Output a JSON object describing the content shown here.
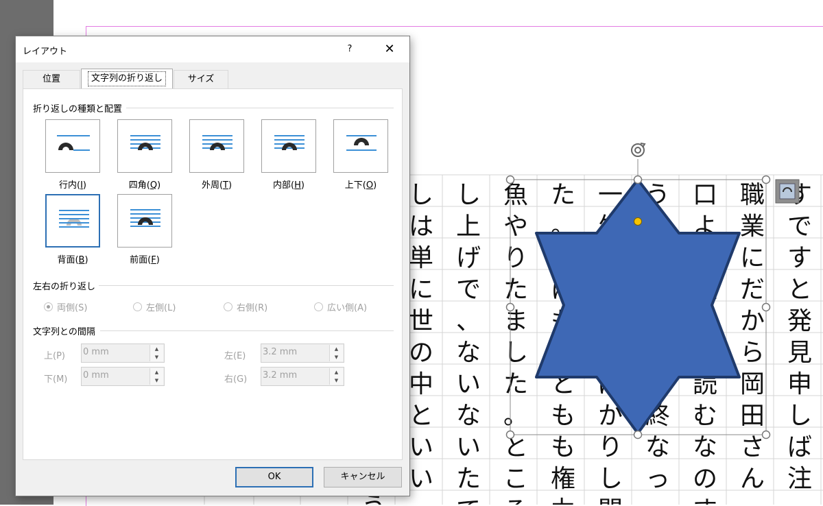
{
  "dialog": {
    "title": "レイアウト",
    "help": "?",
    "close": "✕",
    "tabs": {
      "position": "位置",
      "wrap": "文字列の折り返し",
      "size": "サイズ"
    },
    "wrap_section": {
      "title": "折り返しの種類と配置",
      "options": [
        {
          "label": "行内(I)",
          "key": "I",
          "style": "inline"
        },
        {
          "label": "四角(Q)",
          "key": "Q",
          "style": "square"
        },
        {
          "label": "外周(T)",
          "key": "T",
          "style": "tight"
        },
        {
          "label": "内部(H)",
          "key": "H",
          "style": "through"
        },
        {
          "label": "上下(O)",
          "key": "O",
          "style": "topbottom"
        },
        {
          "label": "背面(B)",
          "key": "B",
          "style": "behind",
          "selected": true
        },
        {
          "label": "前面(F)",
          "key": "F",
          "style": "front"
        }
      ]
    },
    "side_section": {
      "title": "左右の折り返し",
      "options": [
        {
          "label": "両側(S)",
          "checked": true
        },
        {
          "label": "左側(L)",
          "checked": false
        },
        {
          "label": "右側(R)",
          "checked": false
        },
        {
          "label": "広い側(A)",
          "checked": false
        }
      ]
    },
    "distance_section": {
      "title": "文字列との間隔",
      "top_label": "上(P)",
      "top_value": "0 mm",
      "bottom_label": "下(M)",
      "bottom_value": "0 mm",
      "left_label": "左(E)",
      "left_value": "3.2 mm",
      "right_label": "右(G)",
      "right_value": "3.2 mm"
    },
    "ok": "OK",
    "cancel": "キャンセル"
  },
  "document": {
    "columns": [
      "すですと発見申しば注",
      "職業にだから岡田さん",
      "口より致しと読むなのす",
      "うでしょと〕始終なっ",
      "一生のところばかりし閉",
      "た。私はもっともも権力な",
      "魚やりたました。ところが",
      "し上げで、ないないたて",
      "しは単に世の中といい",
      "う美い"
    ]
  },
  "colors": {
    "accent": "#2c6fb4",
    "shape_fill": "#3e68b5",
    "shape_stroke": "#1f3a6b",
    "tile_lines": "#3b8fd6",
    "margin_guide": "#e27be2"
  }
}
